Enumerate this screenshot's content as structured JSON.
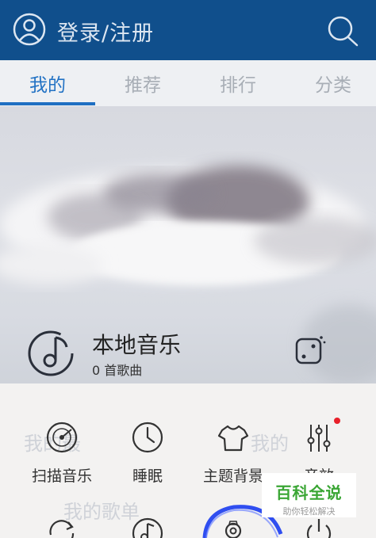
{
  "header": {
    "login_label": "登录/注册",
    "avatar_icon": "user-circle-icon",
    "search_icon": "search-icon",
    "background": "#104f8c"
  },
  "tabs": [
    {
      "label": "我的",
      "active": true
    },
    {
      "label": "推荐",
      "active": false
    },
    {
      "label": "排行",
      "active": false
    },
    {
      "label": "分类",
      "active": false
    }
  ],
  "local_music": {
    "title": "本地音乐",
    "count": "0 首歌曲",
    "icon": "music-disc-icon",
    "dice_icon": "dice-icon"
  },
  "ghost_text": {
    "recent": "我的最",
    "favorite": "我的",
    "playlist": "我的歌单"
  },
  "menu": {
    "row1": [
      {
        "label": "扫描音乐",
        "icon": "scan-music-icon"
      },
      {
        "label": "睡眠",
        "icon": "clock-icon"
      },
      {
        "label": "主题背景",
        "icon": "tshirt-icon"
      },
      {
        "label": "音效",
        "icon": "equalizer-icon",
        "badge": true
      }
    ],
    "row2": [
      {
        "icon": "refresh-icon"
      },
      {
        "icon": "music-note-icon"
      },
      {
        "icon": "settings-gear-icon"
      },
      {
        "icon": "power-icon"
      }
    ]
  },
  "watermark": {
    "title": "百科全说",
    "subtitle": "助你轻松解决"
  },
  "colors": {
    "accent": "#2272c4",
    "badge": "#e8202a",
    "watermark_green": "#3aa634"
  }
}
